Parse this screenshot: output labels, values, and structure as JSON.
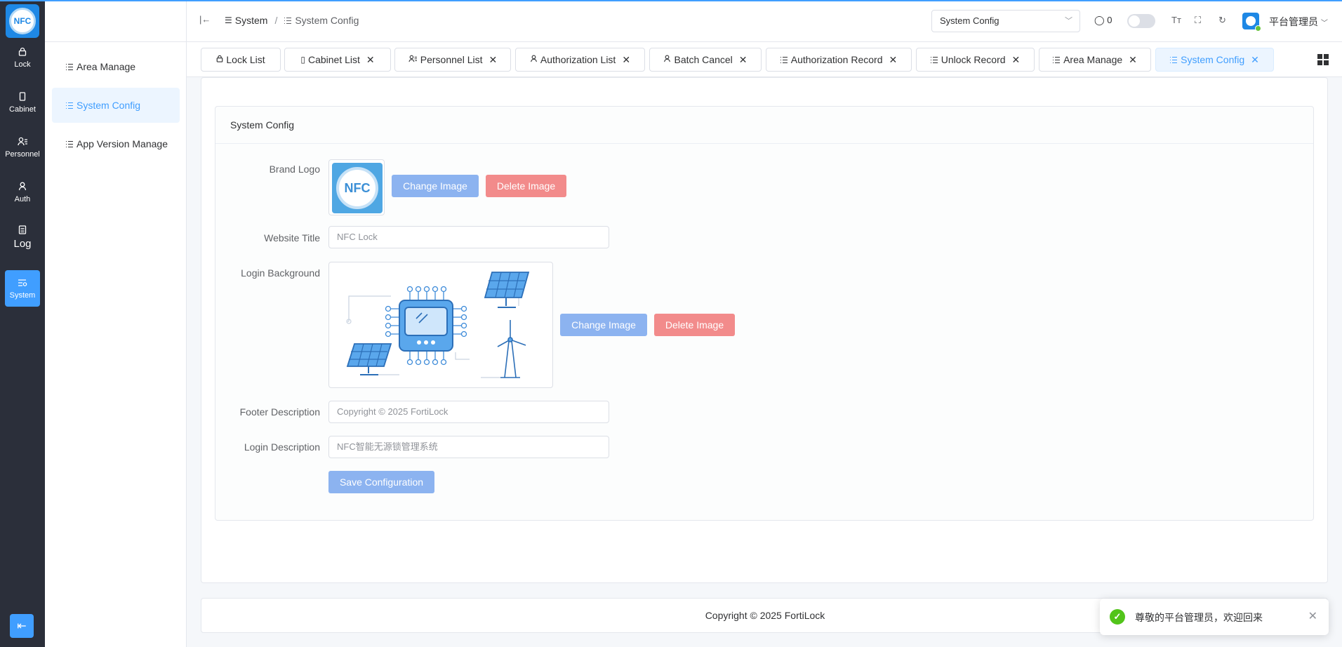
{
  "app": {
    "logo_text": "NFC"
  },
  "rail": {
    "items": [
      {
        "label": "Lock",
        "icon": "lock-icon"
      },
      {
        "label": "Cabinet",
        "icon": "cabinet-icon"
      },
      {
        "label": "Personnel",
        "icon": "personnel-icon"
      },
      {
        "label": "Auth",
        "icon": "user-icon"
      },
      {
        "label": "Log",
        "icon": "log-icon"
      },
      {
        "label": "System",
        "icon": "system-icon",
        "active": true
      }
    ]
  },
  "submenu": {
    "items": [
      {
        "label": "Area Manage"
      },
      {
        "label": "System Config",
        "active": true
      },
      {
        "label": "App Version Manage"
      }
    ]
  },
  "header": {
    "breadcrumb": [
      "System",
      "System Config"
    ],
    "select_value": "System Config",
    "message_count": "0",
    "user_name": "平台管理员"
  },
  "tabs": [
    {
      "label": "Lock List",
      "closable": false
    },
    {
      "label": "Cabinet List",
      "closable": true
    },
    {
      "label": "Personnel List",
      "closable": true
    },
    {
      "label": "Authorization List",
      "closable": true
    },
    {
      "label": "Batch Cancel",
      "closable": true
    },
    {
      "label": "Authorization Record",
      "closable": true
    },
    {
      "label": "Unlock Record",
      "closable": true
    },
    {
      "label": "Area Manage",
      "closable": true
    },
    {
      "label": "System Config",
      "closable": true,
      "active": true
    }
  ],
  "form": {
    "card_title": "System Config",
    "brand_logo_label": "Brand Logo",
    "brand_logo_text": "NFC",
    "website_title_label": "Website Title",
    "website_title_value": "NFC Lock",
    "login_background_label": "Login Background",
    "footer_description_label": "Footer Description",
    "footer_description_value": "Copyright © 2025 FortiLock",
    "login_description_label": "Login Description",
    "login_description_value": "NFC智能无源锁管理系统",
    "change_image": "Change Image",
    "delete_image": "Delete Image",
    "save_button": "Save Configuration"
  },
  "footer": {
    "text": "Copyright © 2025 FortiLock"
  },
  "toast": {
    "message": "尊敬的平台管理员，欢迎回来"
  },
  "colors": {
    "accent": "#409eff",
    "rail_bg": "#2b2f3a",
    "danger_btn": "#f28b8b",
    "primary_btn": "#8cb3f0",
    "success": "#52c41a"
  }
}
